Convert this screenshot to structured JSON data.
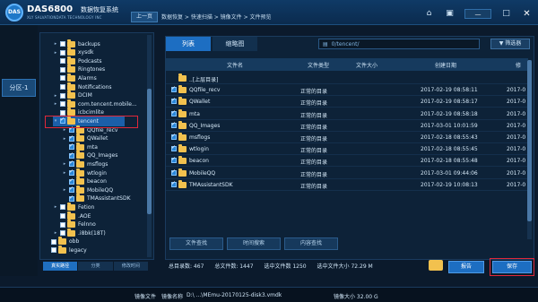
{
  "app": {
    "logo_text": "DAS",
    "brand": "DAS6800",
    "brand_cn": "数据恢复系统",
    "brand_sub": "XLY SALVATIONDATA TECHNOLOGY INC"
  },
  "nav": {
    "back": "上一页",
    "breadcrumb": "数据恢复 > 快速扫描 > 镜像文件 > 文件预览"
  },
  "window_icons": [
    "home-icon",
    "briefcase-icon",
    "minimize-icon",
    "maximize-icon",
    "close-icon"
  ],
  "left_strip": {
    "partition": "分区-1"
  },
  "tree": {
    "rows": [
      {
        "label": "backups",
        "checked": false,
        "expander": "▸",
        "indent": 1
      },
      {
        "label": "xysdk",
        "checked": false,
        "expander": "▸",
        "indent": 1
      },
      {
        "label": "Podcasts",
        "checked": false,
        "expander": "",
        "indent": 1
      },
      {
        "label": "Ringtones",
        "checked": false,
        "expander": "",
        "indent": 1
      },
      {
        "label": "Alarms",
        "checked": false,
        "expander": "",
        "indent": 1
      },
      {
        "label": "Notifications",
        "checked": false,
        "expander": "",
        "indent": 1
      },
      {
        "label": "DCIM",
        "checked": false,
        "expander": "▸",
        "indent": 1
      },
      {
        "label": "com.tencent.mobile...",
        "checked": false,
        "expander": "▸",
        "indent": 1
      },
      {
        "label": "icbcimlite",
        "checked": false,
        "expander": "",
        "indent": 1
      },
      {
        "label": "tencent",
        "checked": true,
        "expander": "▾",
        "indent": 1,
        "selected": true
      },
      {
        "label": "QQfile_recv",
        "checked": true,
        "expander": "▸",
        "indent": 2
      },
      {
        "label": "QWallet",
        "checked": true,
        "expander": "▸",
        "indent": 2
      },
      {
        "label": "mta",
        "checked": true,
        "expander": "",
        "indent": 2
      },
      {
        "label": "QQ_Images",
        "checked": true,
        "expander": "",
        "indent": 2
      },
      {
        "label": "msflogs",
        "checked": true,
        "expander": "▸",
        "indent": 2
      },
      {
        "label": "wtlogin",
        "checked": true,
        "expander": "▸",
        "indent": 2
      },
      {
        "label": "beacon",
        "checked": true,
        "expander": "",
        "indent": 2
      },
      {
        "label": "MobileQQ",
        "checked": true,
        "expander": "▸",
        "indent": 2
      },
      {
        "label": "TMAssistantSDK",
        "checked": true,
        "expander": "",
        "indent": 2
      },
      {
        "label": "Fetion",
        "checked": false,
        "expander": "▸",
        "indent": 1
      },
      {
        "label": ".AOE",
        "checked": false,
        "expander": "",
        "indent": 1
      },
      {
        "label": "Felnno",
        "checked": false,
        "expander": "",
        "indent": 1
      },
      {
        "label": ".i8bk(18T)",
        "checked": false,
        "expander": "▸",
        "indent": 1
      },
      {
        "label": "obb",
        "checked": false,
        "expander": "",
        "indent": 0
      },
      {
        "label": "legacy",
        "checked": false,
        "expander": "",
        "indent": 0
      }
    ],
    "bottom_tabs": [
      "真实路径",
      "分类",
      "修改时间"
    ]
  },
  "main": {
    "tabs": [
      "列表",
      "缩略图"
    ],
    "path": "0/tencent/",
    "filter_label": "筛选器",
    "columns": [
      "文件名",
      "文件类型",
      "文件大小",
      "创建日期",
      "修"
    ],
    "parent_row": "..[上层目录]",
    "rows": [
      {
        "name": "QQfile_recv",
        "type": "正常的目录",
        "size": "",
        "created": "2017-02-19 08:58:11",
        "modified": "2017-0"
      },
      {
        "name": "QWallet",
        "type": "正常的目录",
        "size": "",
        "created": "2017-02-19 08:58:17",
        "modified": "2017-0"
      },
      {
        "name": "mta",
        "type": "正常的目录",
        "size": "",
        "created": "2017-02-19 08:58:18",
        "modified": "2017-0"
      },
      {
        "name": "QQ_Images",
        "type": "正常的目录",
        "size": "",
        "created": "2017-03-01 10:01:59",
        "modified": "2017-0"
      },
      {
        "name": "msflogs",
        "type": "正常的目录",
        "size": "",
        "created": "2017-02-18 08:55:43",
        "modified": "2017-0"
      },
      {
        "name": "wtlogin",
        "type": "正常的目录",
        "size": "",
        "created": "2017-02-18 08:55:45",
        "modified": "2017-0"
      },
      {
        "name": "beacon",
        "type": "正常的目录",
        "size": "",
        "created": "2017-02-18 08:55:48",
        "modified": "2017-0"
      },
      {
        "name": "MobileQQ",
        "type": "正常的目录",
        "size": "",
        "created": "2017-03-01 09:44:06",
        "modified": "2017-0"
      },
      {
        "name": "TMAssistantSDK",
        "type": "正常的目录",
        "size": "",
        "created": "2017-02-19 10:08:13",
        "modified": "2017-0"
      }
    ],
    "bottom_tabs": [
      "文件查找",
      "时间搜索",
      "内容查找"
    ]
  },
  "stats": {
    "total_dirs": "总目录数: 467",
    "total_files": "总文件数: 1447",
    "selected_files": "选中文件数 1250",
    "selected_size": "选中文件大小 72.29 M"
  },
  "actions": {
    "report": "报告",
    "save": "保存"
  },
  "statusbar": {
    "image_file": "镜像文件",
    "image_name_label": "镜像名称",
    "image_path": "D:\\ ...\\MEmu-20170125-disk3.vmdk",
    "image_size": "镜像大小 32.00 G"
  },
  "colors": {
    "accent": "#1d6ec2",
    "highlight_red": "#e0283a",
    "folder": "#f2c14e",
    "bg": "#0b1a2c"
  }
}
